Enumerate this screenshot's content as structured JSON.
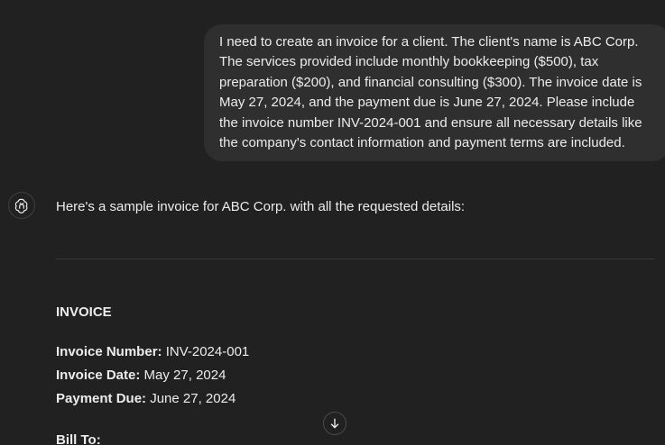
{
  "user_message": "I need to create an invoice for a client. The client's name is ABC Corp. The services provided include monthly bookkeeping ($500), tax preparation ($200), and financial consulting ($300). The invoice date is May 27, 2024, and the payment due is June 27, 2024. Please include the invoice number INV-2024-001 and ensure all necessary details like the company's contact information and payment terms are included.",
  "assistant": {
    "avatar_icon": "openai-logo-icon",
    "intro": "Here's a sample invoice for ABC Corp. with all the requested details:",
    "invoice": {
      "heading": "INVOICE",
      "number_label": "Invoice Number:",
      "number_value": "INV-2024-001",
      "date_label": "Invoice Date:",
      "date_value": "May 27, 2024",
      "due_label": "Payment Due:",
      "due_value": "June 27, 2024",
      "bill_to_label": "Bill To:"
    }
  },
  "scroll_button_icon": "arrow-down-icon"
}
